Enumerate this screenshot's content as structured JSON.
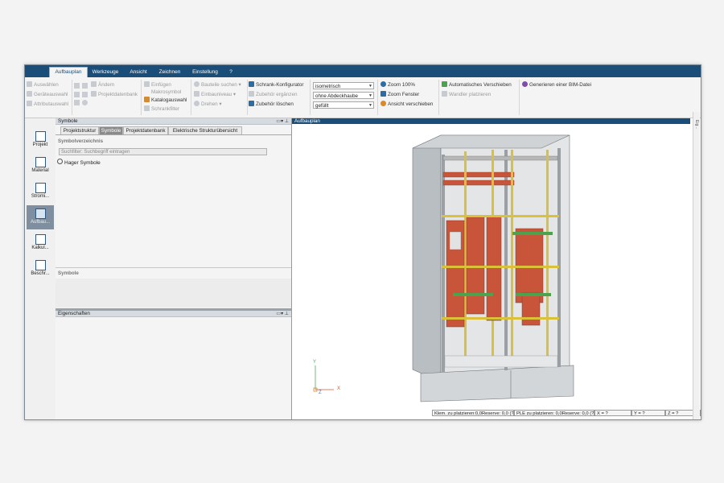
{
  "menu": {
    "tabs": [
      "Aufbauplan",
      "Werkzeuge",
      "Ansicht",
      "Zeichnen",
      "Einstellung",
      "?"
    ]
  },
  "ribbon": {
    "g1": [
      "Auswählen",
      "Geräteauswahl",
      "Attributauswahl"
    ],
    "g2": [
      "Ändern",
      "Projektdatenbank"
    ],
    "g3": [
      "Einfügen",
      "Makrosymbol",
      "Katalogauswahl",
      "Schrankfilter"
    ],
    "g4": [
      "Bauteile suchen",
      "Einbauniveau",
      "Drehen"
    ],
    "g5": [
      "Schrank-Konfigurator",
      "Zubehör ergänzen",
      "Zubehör löschen"
    ],
    "dropdowns": [
      "isometrisch",
      "ohne Abdeckhaube",
      "gefüllt"
    ],
    "g6": [
      "Zoom 100%",
      "Zoom Fenster",
      "Ansicht verschieben"
    ],
    "g7": [
      "Automatisches Verschieben",
      "Wandler platzieren"
    ],
    "g8": [
      "Generieren einer BIM-Datei"
    ]
  },
  "sidebar": {
    "items": [
      "Projekt",
      "Material",
      "Stromi...",
      "Aufbau...",
      "Kalkul...",
      "Beschr..."
    ]
  },
  "symbols_panel": {
    "title": "Symbole",
    "tabs": [
      "Projektstruktur",
      "Symbole",
      "Projektdatenbank",
      "Elektrische Strukturübersicht"
    ],
    "directory_label": "Symbolverzeichnis",
    "search_placeholder": "Suchfilter: Suchbegriff eintragen",
    "tree_root": "Hager Symbole",
    "symbols_section": "Symbole"
  },
  "properties_panel": {
    "title": "Eigenschaften"
  },
  "viewport": {
    "title": "Aufbauplan",
    "axis_y": "Y",
    "axis_z": "Z",
    "axis_x": "X",
    "side_tab": "Eig..."
  },
  "status": {
    "klem": "Klem. zu platzieren:0,0Reserve: 0,0 (?%)",
    "ple": "PLE zu platzieren: 0,0Reserve: 0,0 (?%)",
    "x": "X = ?",
    "y": "Y = ?",
    "z": "Z = ?"
  },
  "colors": {
    "accent": "#1a4d77",
    "copper": "#c8553a",
    "busbar_yellow": "#d9c23a",
    "rail_green": "#4da34d",
    "cabinet_grey": "#cfd3d6"
  }
}
